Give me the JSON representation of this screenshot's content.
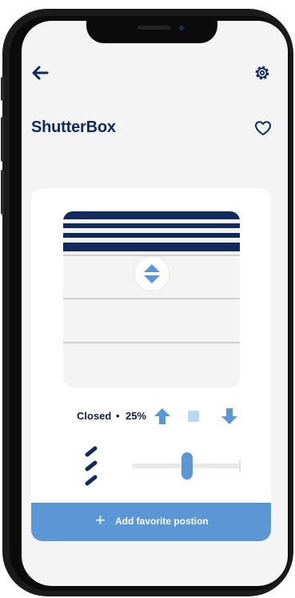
{
  "header": {
    "back_icon": "arrow-left-icon",
    "settings_icon": "gear-icon",
    "title": "ShutterBox",
    "favorite_icon": "heart-outline-icon"
  },
  "shutter": {
    "open_fraction": 0.25,
    "knob_icon": "up-down-arrows-icon",
    "status_label": "Closed",
    "separator": "•",
    "percent_label": "25%",
    "up_icon": "arrow-up-icon",
    "stop_icon": "stop-square-icon",
    "down_icon": "arrow-down-icon"
  },
  "tilt": {
    "icon": "tilt-slats-icon",
    "slider_value_fraction": 0.5
  },
  "add_favorite": {
    "icon": "plus-icon",
    "label": "Add favorite postion"
  },
  "colors": {
    "navy": "#102a5c",
    "accent_blue": "#5b97d4",
    "stop_light_blue": "#b8d8f6",
    "background": "#f4f4f4"
  }
}
